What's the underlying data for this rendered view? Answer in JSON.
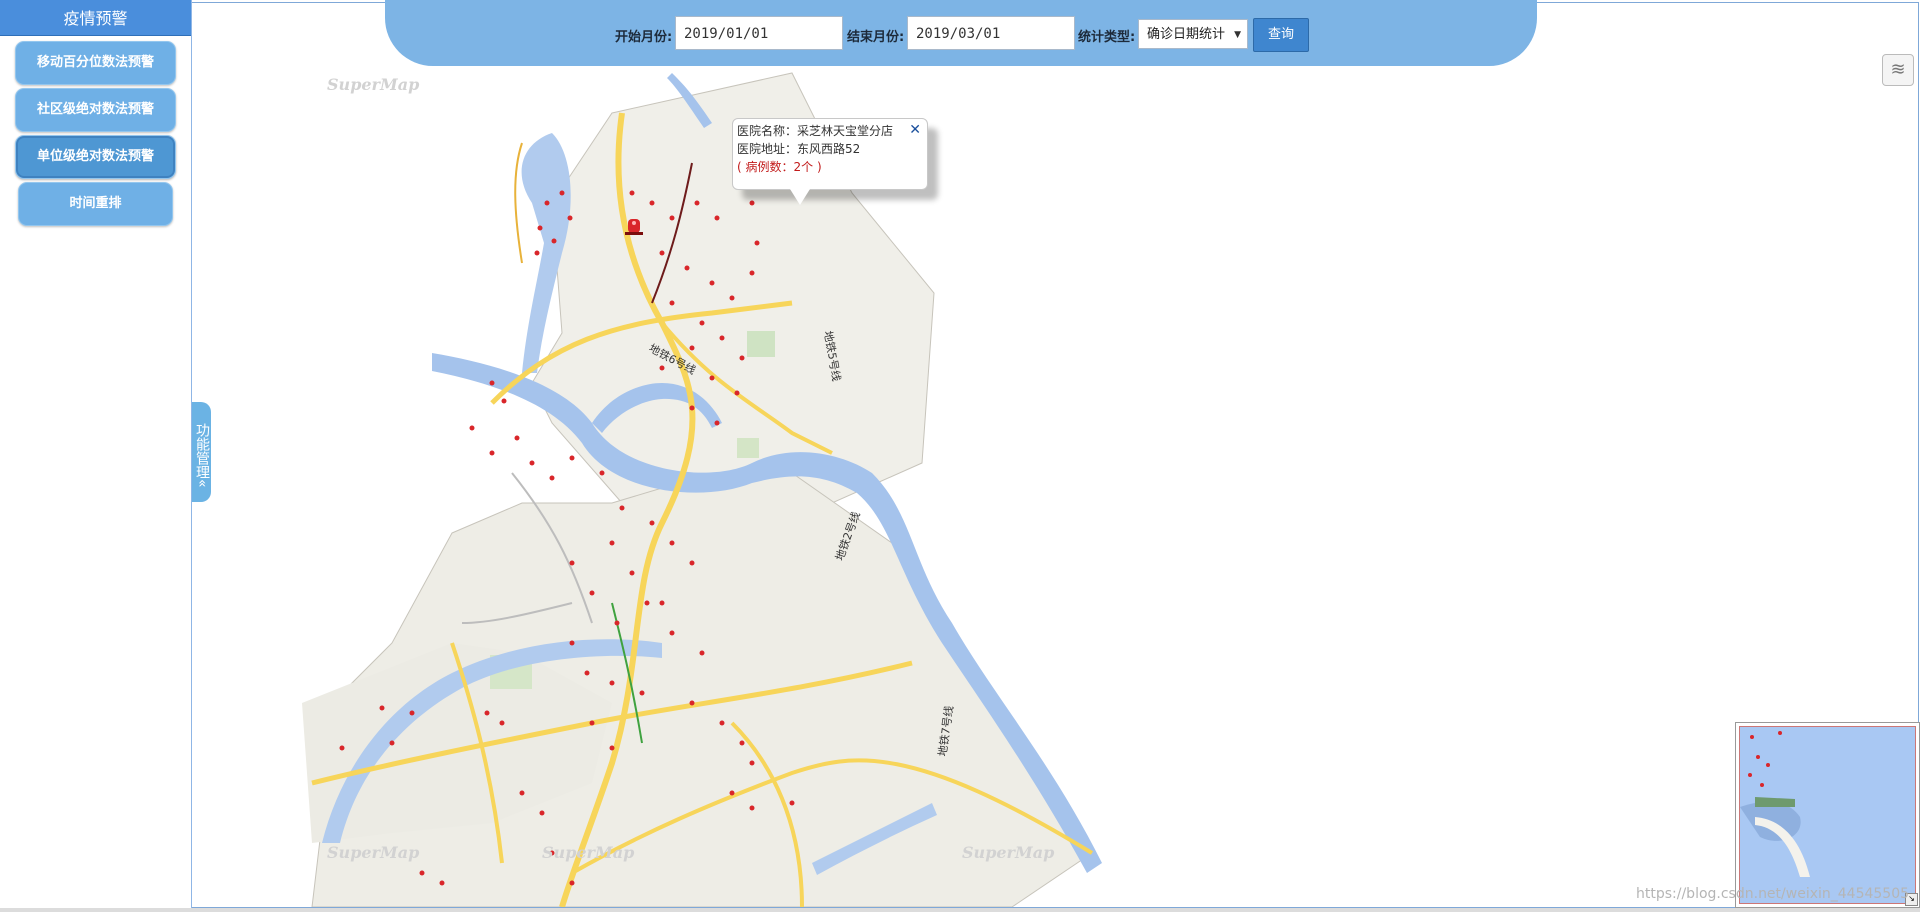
{
  "sidebar": {
    "title": "疫情预警",
    "buttons": [
      {
        "label": "移动百分位数法预警"
      },
      {
        "label": "社区级绝对数法预警"
      },
      {
        "label": "单位级绝对数法预警"
      },
      {
        "label": "时间重排"
      }
    ]
  },
  "func_tab": {
    "label": "功能管理«"
  },
  "query": {
    "start_label": "开始月份:",
    "start_value": "2019/01/01",
    "end_label": "结束月份:",
    "end_value": "2019/03/01",
    "type_label": "统计类型:",
    "type_value": "确诊日期统计",
    "submit_label": "查询"
  },
  "popup": {
    "name_line": "医院名称：采芝林天宝堂分店",
    "addr_line": "医院地址：东风西路52",
    "count_line": "( 病例数：2个 )",
    "close": "✕"
  },
  "watermark": "SuperMap",
  "road_labels": [
    "地铁6号线",
    "地铁5号线",
    "地铁2号线",
    "地铁7号线"
  ],
  "credit": "https://blog.csdn.net/weixin_44545505",
  "icons": {
    "layer": "layers-icon",
    "marker": "alarm-marker-icon",
    "case": "case-marker-icon"
  },
  "colors": {
    "sidebar_title": "#4a8edc",
    "button": "#6fb0e6",
    "query_bar": "#7db4e5",
    "water": "#a5c3ec",
    "road": "#f7d55a",
    "case": "#d9262a"
  }
}
